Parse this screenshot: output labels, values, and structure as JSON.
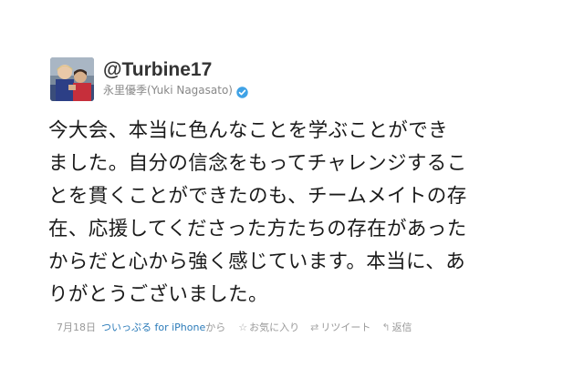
{
  "user": {
    "screen_name": "@Turbine17",
    "full_name": "永里優季(Yuki Nagasato)",
    "avatar_icon": "user-avatar-photo",
    "verified_icon": "verified-badge-icon"
  },
  "tweet": {
    "lines": [
      "今大会、本当に色んなことを学ぶことができ",
      "ました。自分の信念をもってチャレンジするこ",
      "とを貫くことができたのも、チームメイトの存",
      "在、応援してくださった方たちの存在があった",
      "からだと心から強く感じています。本当に、あ",
      "りがとうございました。"
    ]
  },
  "meta": {
    "date": "7月18日",
    "source": "ついっぷる for iPhone",
    "source_suffix": "から",
    "favorite_label": "お気に入り",
    "retweet_label": "リツイート",
    "reply_label": "返信",
    "favorite_icon": "star-icon",
    "retweet_icon": "retweet-icon",
    "reply_icon": "reply-arrow-icon"
  },
  "colors": {
    "text": "#1a1a1a",
    "screen_name": "#333333",
    "meta_gray": "#999999",
    "link_blue": "#2b7bb9",
    "verified_blue": "#3fa2e6"
  }
}
